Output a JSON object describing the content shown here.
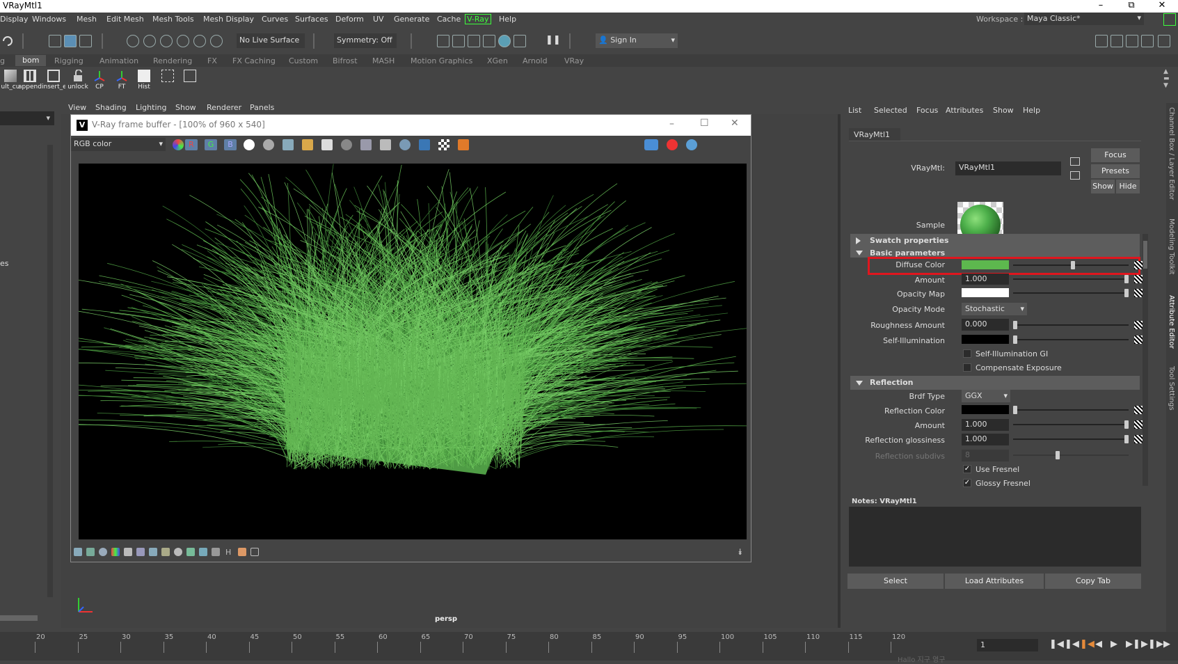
{
  "window": {
    "title": "VRayMtl1"
  },
  "menubar": {
    "items": [
      "Display",
      "Windows",
      "Mesh",
      "Edit Mesh",
      "Mesh Tools",
      "Mesh Display",
      "Curves",
      "Surfaces",
      "Deform",
      "UV",
      "Generate",
      "Cache",
      "V-Ray",
      "Help"
    ],
    "workspace_label": "Workspace :",
    "workspace_value": "Maya Classic*"
  },
  "toolbar": {
    "live_surface": "No Live Surface",
    "symmetry": "Symmetry: Off",
    "sign_in": "Sign In"
  },
  "shelf": {
    "tabs": [
      "g",
      "bom",
      "Rigging",
      "Animation",
      "Rendering",
      "FX",
      "FX Caching",
      "Custom",
      "Bifrost",
      "MASH",
      "Motion Graphics",
      "XGen",
      "Arnold",
      "VRay"
    ],
    "active_tab": "bom",
    "buttons": [
      "ult_cu",
      "append",
      "insert_e",
      "unlock",
      "CP",
      "FT",
      "Hist",
      "",
      ""
    ]
  },
  "viewport": {
    "menus": [
      "View",
      "Shading",
      "Lighting",
      "Show",
      "Renderer",
      "Panels"
    ],
    "camera_label": "persp",
    "left_label": "es"
  },
  "vfb": {
    "title": "V-Ray frame buffer - [100% of 960 x 540]",
    "channel": "RGB color",
    "channel_buttons": [
      "R",
      "G",
      "B"
    ],
    "bottom_h_label": "H"
  },
  "attribute_editor": {
    "menus": [
      "List",
      "Selected",
      "Focus",
      "Attributes",
      "Show",
      "Help"
    ],
    "tab": "VRayMtl1",
    "type_label": "VRayMtl:",
    "name_value": "VRayMtl1",
    "buttons": {
      "focus": "Focus",
      "presets": "Presets",
      "show": "Show",
      "hide": "Hide"
    },
    "sample_label": "Sample",
    "sections": {
      "swatch": "Swatch properties",
      "basic": "Basic parameters",
      "reflection": "Reflection"
    },
    "basic": {
      "diffuse_color": {
        "label": "Diffuse Color",
        "swatch": "#5db84e",
        "slider": 0.52
      },
      "amount": {
        "label": "Amount",
        "value": "1.000",
        "slider": 1.0
      },
      "opacity_map": {
        "label": "Opacity Map",
        "swatch": "#ffffff",
        "slider": 1.0
      },
      "opacity_mode": {
        "label": "Opacity Mode",
        "value": "Stochastic"
      },
      "roughness_amount": {
        "label": "Roughness Amount",
        "value": "0.000",
        "slider": 0.0
      },
      "self_illumination": {
        "label": "Self-Illumination",
        "swatch": "#000000",
        "slider": 0.0
      },
      "self_illum_gi": {
        "label": "Self-Illumination GI",
        "checked": false
      },
      "compensate_exposure": {
        "label": "Compensate Exposure",
        "checked": false
      }
    },
    "reflection": {
      "brdf_type": {
        "label": "Brdf Type",
        "value": "GGX"
      },
      "reflection_color": {
        "label": "Reflection Color",
        "swatch": "#000000",
        "slider": 0.0
      },
      "amount": {
        "label": "Amount",
        "value": "1.000",
        "slider": 1.0
      },
      "glossiness": {
        "label": "Reflection glossiness",
        "value": "1.000",
        "slider": 1.0
      },
      "subdivs": {
        "label": "Reflection subdivs",
        "value": "8",
        "slider": 0.38
      },
      "use_fresnel": {
        "label": "Use Fresnel",
        "checked": true
      },
      "glossy_fresnel": {
        "label": "Glossy Fresnel",
        "checked": true
      }
    },
    "notes_label": "Notes:  VRayMtl1",
    "bottom_buttons": {
      "select": "Select",
      "load": "Load Attributes",
      "copy": "Copy Tab"
    },
    "side_tabs": [
      "Channel Box / Layer Editor",
      "Modeling Toolkit",
      "Attribute Editor",
      "Tool Settings"
    ]
  },
  "timeline": {
    "ticks": [
      20,
      25,
      30,
      35,
      40,
      45,
      50,
      55,
      60,
      65,
      70,
      75,
      80,
      85,
      90,
      95,
      100,
      105,
      110,
      115,
      120
    ],
    "current_frame": "1",
    "bottom_text": "Hallo 지구 영구"
  },
  "colors": {
    "accent_highlight": "#e0161e",
    "vray_green": "#3cff3c",
    "grass_green": "#5db84e"
  }
}
